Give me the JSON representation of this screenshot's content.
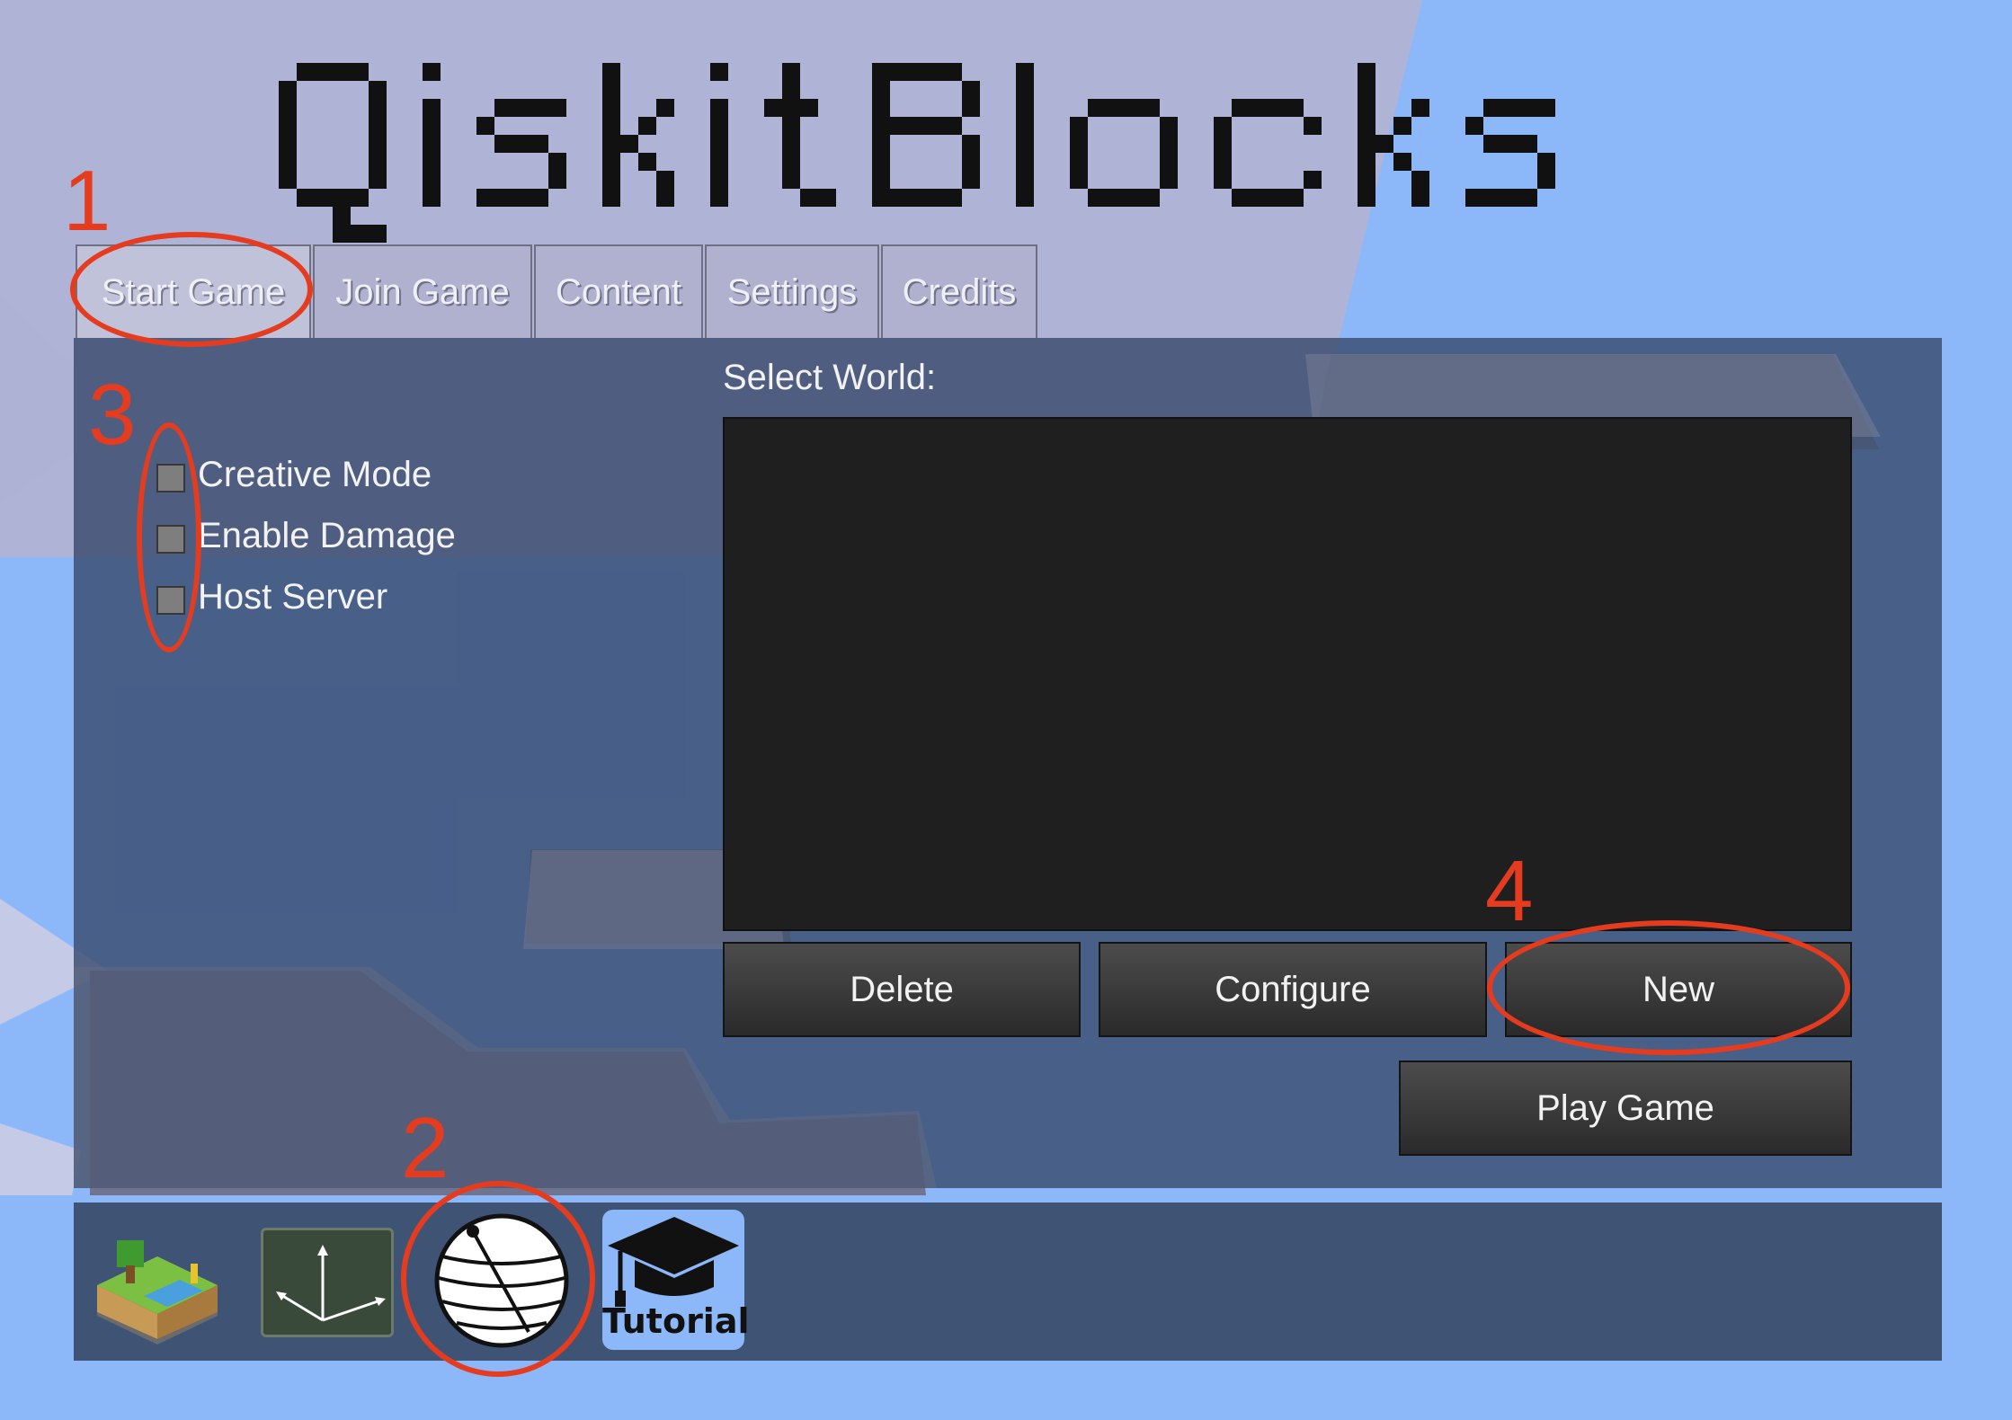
{
  "app": {
    "title": "QiskitBlocks"
  },
  "tabs": [
    {
      "label": "Start Game",
      "active": true
    },
    {
      "label": "Join Game",
      "active": false
    },
    {
      "label": "Content",
      "active": false
    },
    {
      "label": "Settings",
      "active": false
    },
    {
      "label": "Credits",
      "active": false
    }
  ],
  "options": [
    {
      "label": "Creative Mode",
      "checked": false
    },
    {
      "label": "Enable Damage",
      "checked": false
    },
    {
      "label": "Host Server",
      "checked": false
    }
  ],
  "world": {
    "select_label": "Select World:",
    "worlds": []
  },
  "buttons": {
    "delete": "Delete",
    "configure": "Configure",
    "new": "New",
    "play": "Play Game"
  },
  "games": [
    {
      "icon": "minetest-game-icon"
    },
    {
      "icon": "axes-icon"
    },
    {
      "icon": "bloch-sphere-icon"
    },
    {
      "icon": "graduation-cap-icon",
      "label": "Tutorial"
    }
  ],
  "annotations": [
    "1",
    "2",
    "3",
    "4"
  ],
  "colors": {
    "sky": "#8cb8fa",
    "panel": "#344668",
    "annotation": "#e53c1f",
    "tutorial_bg": "#8cb8fa"
  }
}
